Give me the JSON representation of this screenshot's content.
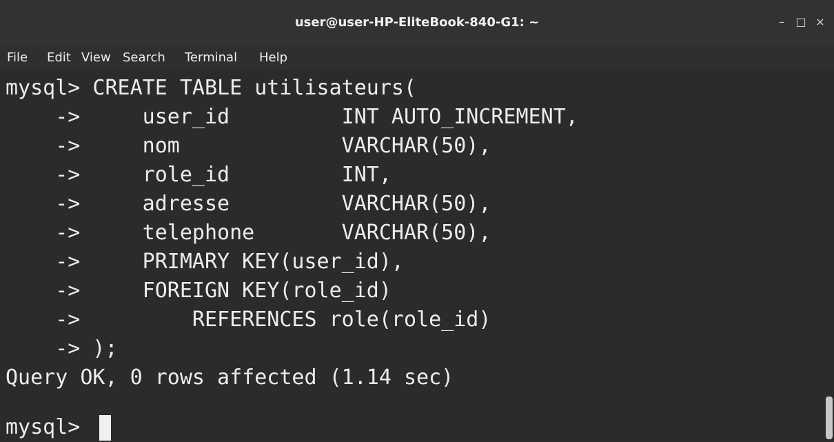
{
  "window": {
    "title": "user@user-HP-EliteBook-840-G1: ~",
    "minimize": "–",
    "maximize": "□",
    "close": "×"
  },
  "menu": {
    "file": "File",
    "edit": "Edit",
    "view": "View",
    "search": "Search",
    "terminal": "Terminal",
    "help": "Help"
  },
  "terminal": {
    "lines": [
      "mysql> CREATE TABLE utilisateurs(",
      "    ->     user_id         INT AUTO_INCREMENT,",
      "    ->     nom             VARCHAR(50),",
      "    ->     role_id         INT,",
      "    ->     adresse         VARCHAR(50),",
      "    ->     telephone       VARCHAR(50),",
      "    ->     PRIMARY KEY(user_id),",
      "    ->     FOREIGN KEY(role_id)",
      "    ->         REFERENCES role(role_id)",
      "    -> );",
      "Query OK, 0 rows affected (1.14 sec)",
      "",
      "mysql> "
    ]
  },
  "colors": {
    "terminal_bg": "#2b2b2b",
    "text": "#ececec",
    "titlebar": "#323232"
  }
}
